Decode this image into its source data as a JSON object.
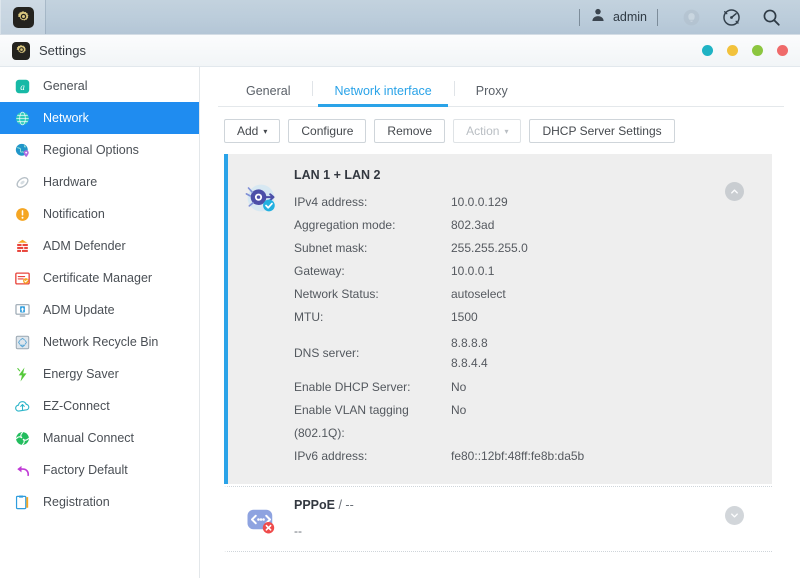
{
  "desktop": {
    "app_icon": "gear-icon",
    "user_label": "admin",
    "user_icon": "user-icon",
    "icons": [
      {
        "name": "notification-bell-icon"
      },
      {
        "name": "activity-monitor-icon"
      },
      {
        "name": "search-icon"
      }
    ]
  },
  "window": {
    "title": "Settings",
    "title_icon": "gear-icon",
    "controls": [
      {
        "name": "pin-button",
        "color": "#1fb3c4"
      },
      {
        "name": "minimize-button",
        "color": "#f2c23c"
      },
      {
        "name": "maximize-button",
        "color": "#8cc63f"
      },
      {
        "name": "close-button",
        "color": "#ef6a6a"
      }
    ]
  },
  "sidebar": {
    "items": [
      {
        "label": "General",
        "icon": "general-icon",
        "active": false
      },
      {
        "label": "Network",
        "icon": "network-icon",
        "active": true
      },
      {
        "label": "Regional Options",
        "icon": "regional-options-icon",
        "active": false
      },
      {
        "label": "Hardware",
        "icon": "hardware-icon",
        "active": false
      },
      {
        "label": "Notification",
        "icon": "notification-icon",
        "active": false
      },
      {
        "label": "ADM Defender",
        "icon": "adm-defender-icon",
        "active": false
      },
      {
        "label": "Certificate Manager",
        "icon": "certificate-manager-icon",
        "active": false
      },
      {
        "label": "ADM Update",
        "icon": "adm-update-icon",
        "active": false
      },
      {
        "label": "Network Recycle Bin",
        "icon": "network-recycle-bin-icon",
        "active": false
      },
      {
        "label": "Energy Saver",
        "icon": "energy-saver-icon",
        "active": false
      },
      {
        "label": "EZ-Connect",
        "icon": "ez-connect-icon",
        "active": false
      },
      {
        "label": "Manual Connect",
        "icon": "manual-connect-icon",
        "active": false
      },
      {
        "label": "Factory Default",
        "icon": "factory-default-icon",
        "active": false
      },
      {
        "label": "Registration",
        "icon": "registration-icon",
        "active": false
      }
    ]
  },
  "tabs": [
    {
      "label": "General",
      "active": false
    },
    {
      "label": "Network interface",
      "active": true
    },
    {
      "label": "Proxy",
      "active": false
    }
  ],
  "toolbar": {
    "add_label": "Add",
    "add_caret": "▾",
    "configure_label": "Configure",
    "remove_label": "Remove",
    "action_label": "Action",
    "action_caret": "▾",
    "dhcp_label": "DHCP Server Settings"
  },
  "interfaces": [
    {
      "title": "LAN 1 + LAN 2",
      "icon": "lan-bonded-connected-icon",
      "expanded": true,
      "chevron": "chevron-up-icon",
      "details": [
        {
          "label": "IPv4 address:",
          "value": "10.0.0.129"
        },
        {
          "label": "Aggregation mode:",
          "value": "802.3ad"
        },
        {
          "label": "Subnet mask:",
          "value": "255.255.255.0"
        },
        {
          "label": "Gateway:",
          "value": "10.0.0.1"
        },
        {
          "label": "Network Status:",
          "value": "autoselect"
        },
        {
          "label": "MTU:",
          "value": "1500"
        }
      ],
      "dns": {
        "label": "DNS server:",
        "values": [
          "8.8.8.8",
          "8.8.4.4"
        ]
      },
      "details_after": [
        {
          "label": "Enable DHCP Server:",
          "value": "No"
        },
        {
          "label": "Enable VLAN tagging (802.1Q):",
          "value": "No"
        },
        {
          "label": "IPv6 address:",
          "value": "fe80::12bf:48ff:fe8b:da5b"
        }
      ]
    },
    {
      "title": "PPPoE",
      "title_suffix": "/ --",
      "icon": "pppoe-disconnected-icon",
      "expanded": false,
      "chevron": "chevron-down-icon",
      "status": "--"
    }
  ]
}
